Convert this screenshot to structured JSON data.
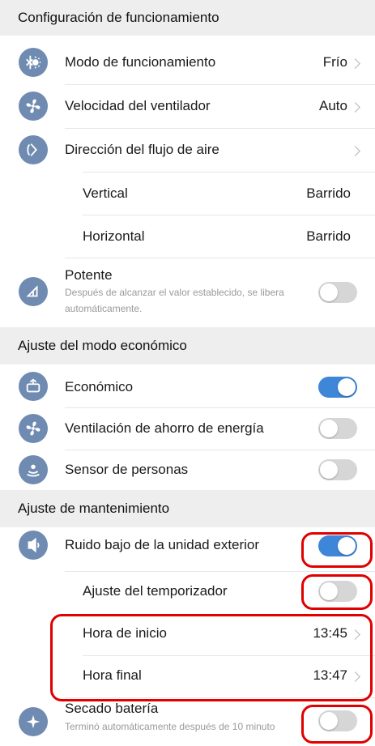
{
  "sections": {
    "operation": {
      "title": "Configuración de funcionamiento",
      "mode": {
        "label": "Modo de funcionamiento",
        "value": "Frío",
        "icon": "sun-snow-icon"
      },
      "fan_speed": {
        "label": "Velocidad del ventilador",
        "value": "Auto",
        "icon": "fan-icon"
      },
      "airflow": {
        "label": "Dirección del flujo de aire",
        "icon": "airflow-direction-icon"
      },
      "vertical": {
        "label": "Vertical",
        "value": "Barrido"
      },
      "horizontal": {
        "label": "Horizontal",
        "value": "Barrido"
      },
      "powerful": {
        "label": "Potente",
        "description": "Después de alcanzar el valor establecido, se libera automáticamente.",
        "enabled": false,
        "icon": "powerful-icon"
      }
    },
    "economy": {
      "title": "Ajuste del modo económico",
      "economic": {
        "label": "Económico",
        "enabled": true,
        "icon": "econo-icon"
      },
      "energy_vent": {
        "label": "Ventilación de ahorro de energía",
        "enabled": false,
        "icon": "fan-icon"
      },
      "person_sensor": {
        "label": "Sensor de personas",
        "enabled": false,
        "icon": "sensor-icon"
      }
    },
    "maintenance": {
      "title": "Ajuste de mantenimiento",
      "outdoor_low_noise": {
        "label": "Ruido bajo de la unidad exterior",
        "enabled": true,
        "icon": "low-noise-icon"
      },
      "timer": {
        "label": "Ajuste del temporizador",
        "enabled": false
      },
      "start_time": {
        "label": "Hora de inicio",
        "value": "13:45"
      },
      "end_time": {
        "label": "Hora final",
        "value": "13:47"
      },
      "drying": {
        "label": "Secado batería",
        "description": "Terminó automáticamente después de 10 minuto",
        "enabled": false,
        "icon": "sparkle-icon"
      }
    }
  },
  "colors": {
    "accent": "#3d86d8",
    "icon_bg": "#6f8bb1",
    "highlight": "#e00000",
    "section_bg": "#eeeeee"
  }
}
